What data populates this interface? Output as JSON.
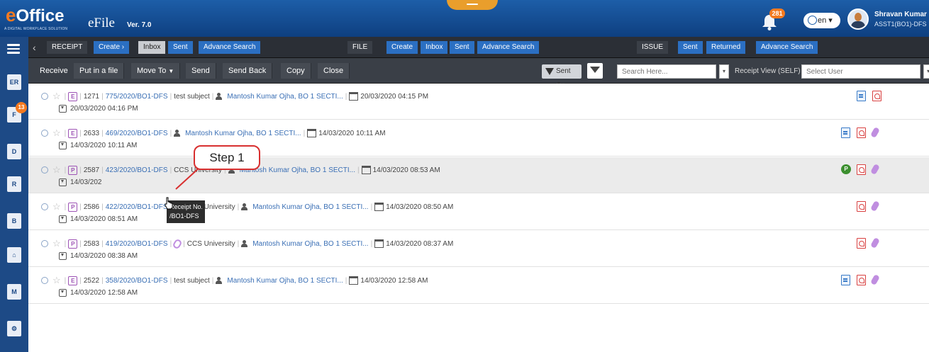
{
  "app": {
    "logo_e": "e",
    "logo_rest": "Office",
    "logo_tagline": "A DIGITAL WORKPLACE SOLUTION",
    "product": "eFile",
    "version": "Ver. 7.0",
    "notifications_count": "281",
    "language": "en",
    "user_name": "Shravan Kumar",
    "user_role": "ASST1(BO1)-DFS"
  },
  "rail": {
    "file_badge": "13",
    "items": [
      "receipt-icon",
      "file-icon",
      "dispatch-icon",
      "e-receipt-icon",
      "bulk-icon",
      "home-icon",
      "tracking-icon",
      "settings-icon"
    ]
  },
  "nav": {
    "receipt": "RECEIPT",
    "receipt_create": "Create ›",
    "receipt_inbox": "Inbox",
    "receipt_sent": "Sent",
    "receipt_search": "Advance Search",
    "file": "FILE",
    "file_create": "Create",
    "file_inbox": "Inbox",
    "file_sent": "Sent",
    "file_search": "Advance Search",
    "issue": "ISSUE",
    "issue_sent": "Sent",
    "issue_returned": "Returned",
    "issue_search": "Advance Search"
  },
  "toolbar": {
    "receive": "Receive",
    "put_in_file": "Put in a file",
    "move_to": "Move To",
    "send": "Send",
    "send_back": "Send Back",
    "copy": "Copy",
    "close": "Close",
    "sent_on": "Sent On",
    "search_placeholder": "Search Here...",
    "receipt_view": "Receipt View (SELF)",
    "user_placeholder": "Select User"
  },
  "rows": [
    {
      "type": "E",
      "number": "1271",
      "receipt_no": "775/2020/BO1-DFS",
      "subject": "test subject",
      "clip": false,
      "sender": "Mantosh Kumar Ojha, BO 1 SECTI...",
      "sent_on": "20/03/2020 04:15 PM",
      "due": "20/03/2020 04:16 PM",
      "actions": [
        "doc",
        "pdf"
      ]
    },
    {
      "type": "E",
      "number": "2633",
      "receipt_no": "469/2020/BO1-DFS",
      "subject": "",
      "clip": false,
      "sender": "Mantosh Kumar Ojha, BO 1 SECTI...",
      "sent_on": "14/03/2020 10:11 AM",
      "due": "14/03/2020 10:11 AM",
      "actions": [
        "doc",
        "pdf",
        "attach"
      ]
    },
    {
      "type": "P",
      "number": "2587",
      "receipt_no": "423/2020/BO1-DFS",
      "subject": "CCS University",
      "clip": false,
      "sender": "Mantosh Kumar Ojha, BO 1 SECTI...",
      "sent_on": "14/03/2020 08:53 AM",
      "due": "14/03/202",
      "actions": [
        "p",
        "pdf",
        "attach"
      ]
    },
    {
      "type": "P",
      "number": "2586",
      "receipt_no": "422/2020/BO1-DFS",
      "subject": "CCS University",
      "clip": true,
      "sender": "Mantosh Kumar Ojha, BO 1 SECTI...",
      "sent_on": "14/03/2020 08:50 AM",
      "due": "14/03/2020 08:51 AM",
      "actions": [
        "pdf",
        "attach"
      ]
    },
    {
      "type": "P",
      "number": "2583",
      "receipt_no": "419/2020/BO1-DFS",
      "subject": "CCS University",
      "clip": true,
      "sender": "Mantosh Kumar Ojha, BO 1 SECTI...",
      "sent_on": "14/03/2020 08:37 AM",
      "due": "14/03/2020 08:38 AM",
      "actions": [
        "pdf",
        "attach"
      ]
    },
    {
      "type": "E",
      "number": "2522",
      "receipt_no": "358/2020/BO1-DFS",
      "subject": "test subject",
      "clip": false,
      "sender": "Mantosh Kumar Ojha, BO 1 SECTI...",
      "sent_on": "14/03/2020 12:58 AM",
      "due": "14/03/2020 12:58 AM",
      "actions": [
        "doc",
        "pdf",
        "attach"
      ]
    }
  ],
  "annotation": {
    "step": "Step 1",
    "tooltip_line1": "Receipt No. : 423/2020",
    "tooltip_line2": "/BO1-DFS"
  },
  "colors": {
    "header": "#1d5ea8",
    "accent": "#f47a20",
    "link": "#3a6fb5",
    "callout_border": "#d83030"
  }
}
